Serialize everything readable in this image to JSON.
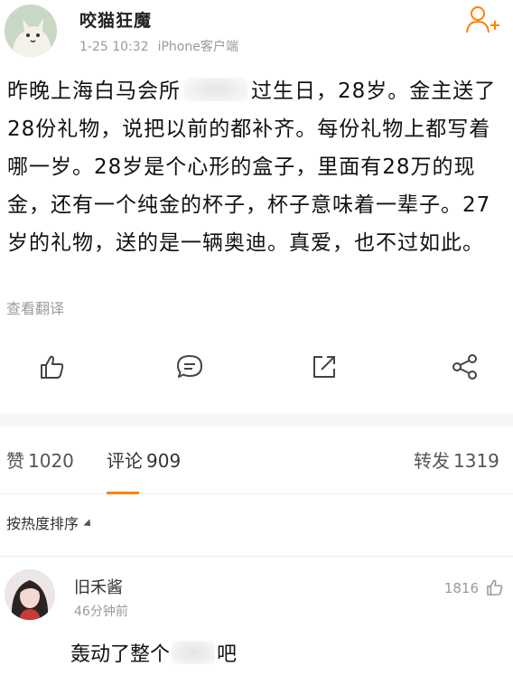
{
  "post": {
    "author": "咬猫狂魔",
    "time": "1-25 10:32",
    "source": "iPhone客户端",
    "text_before_redaction": "昨晚上海白马会所",
    "text_after_redaction": "过生日，28岁。金主送了28份礼物，说把以前的都补齐。每份礼物上都写着哪一岁。28岁是个心形的盒子，里面有28万的现金，还有一个纯金的杯子，杯子意味着一辈子。27岁的礼物，送的是一辆奥迪。真爱，也不过如此。",
    "translate_label": "查看翻译",
    "follow_icon": "add-user-icon"
  },
  "actions": {
    "like_icon": "thumbs-up-icon",
    "comment_icon": "comment-bubble-icon",
    "share_icon": "external-share-icon",
    "more_share_icon": "share-nodes-icon"
  },
  "tabs": {
    "likes_label": "赞",
    "likes_count": "1020",
    "comments_label": "评论",
    "comments_count": "909",
    "reposts_label": "转发",
    "reposts_count": "1319",
    "active_color": "#ff8200"
  },
  "sort": {
    "label": "按热度排序"
  },
  "comment": {
    "user": "旧禾酱",
    "time": "46分钟前",
    "likes": "1816",
    "text_before": "轰动了整个",
    "text_after": "吧"
  }
}
